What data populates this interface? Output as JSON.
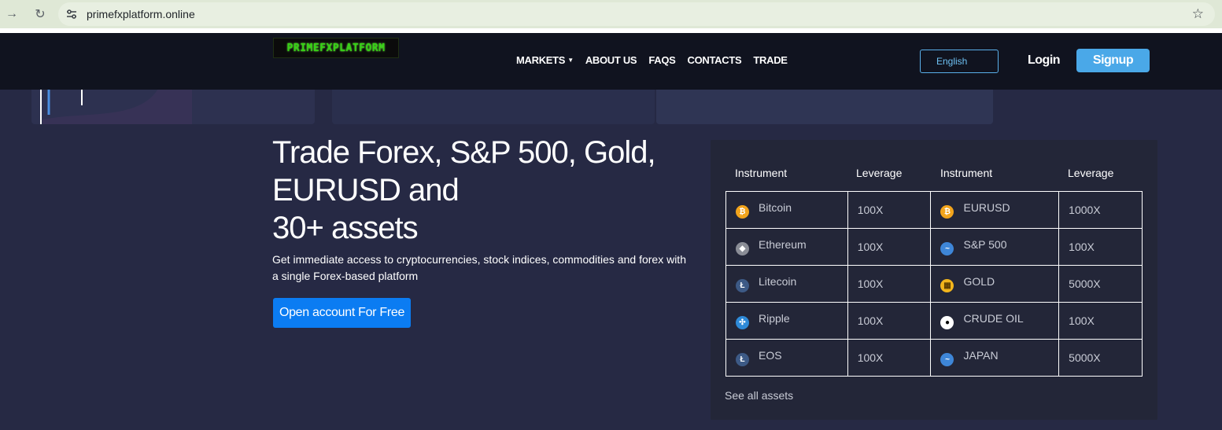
{
  "browser": {
    "url": "primefxplatform.online",
    "icons": [
      "forward-arrow-icon",
      "reload-icon",
      "site-settings-icon",
      "bookmark-star-icon"
    ]
  },
  "header": {
    "logo_text": "PRIMEFXPLATFORM",
    "logo_color": "#36d116",
    "menu": [
      {
        "label": "MARKETS",
        "has_dropdown": true
      },
      {
        "label": "ABOUT US"
      },
      {
        "label": "FAQS"
      },
      {
        "label": "CONTACTS"
      },
      {
        "label": "TRADE"
      }
    ],
    "language": "English",
    "login_label": "Login",
    "signup_label": "Signup",
    "accent_color": "#4aa8e8"
  },
  "hero": {
    "title_line1": "Trade Forex, S&P 500, Gold,",
    "title_line2": "EURUSD and",
    "title_line3": "30+ assets",
    "subtitle": "Get immediate access to cryptocurrencies, stock indices, commodities and forex with a single Forex-based platform",
    "cta_label": "Open account For Free",
    "cta_color": "#0b7cf2"
  },
  "instruments": {
    "headers": [
      "Instrument",
      "Leverage",
      "Instrument",
      "Leverage"
    ],
    "rows": [
      {
        "left": {
          "name": "Bitcoin",
          "icon": "bitcoin-icon",
          "leverage": "100X"
        },
        "right": {
          "name": "EURUSD",
          "icon": "bitcoin-icon",
          "leverage": "1000X"
        }
      },
      {
        "left": {
          "name": "Ethereum",
          "icon": "ethereum-icon",
          "leverage": "100X"
        },
        "right": {
          "name": "S&P 500",
          "icon": "chart-line-icon",
          "leverage": "100X"
        }
      },
      {
        "left": {
          "name": "Litecoin",
          "icon": "litecoin-icon",
          "leverage": "100X"
        },
        "right": {
          "name": "GOLD",
          "icon": "gold-icon",
          "leverage": "5000X"
        }
      },
      {
        "left": {
          "name": "Ripple",
          "icon": "ripple-icon",
          "leverage": "100X"
        },
        "right": {
          "name": "CRUDE OIL",
          "icon": "oil-drop-icon",
          "leverage": "100X"
        }
      },
      {
        "left": {
          "name": "EOS",
          "icon": "eos-icon",
          "leverage": "100X"
        },
        "right": {
          "name": "JAPAN",
          "icon": "chart-line-icon",
          "leverage": "5000X"
        }
      }
    ],
    "see_all_label": "See all assets"
  }
}
